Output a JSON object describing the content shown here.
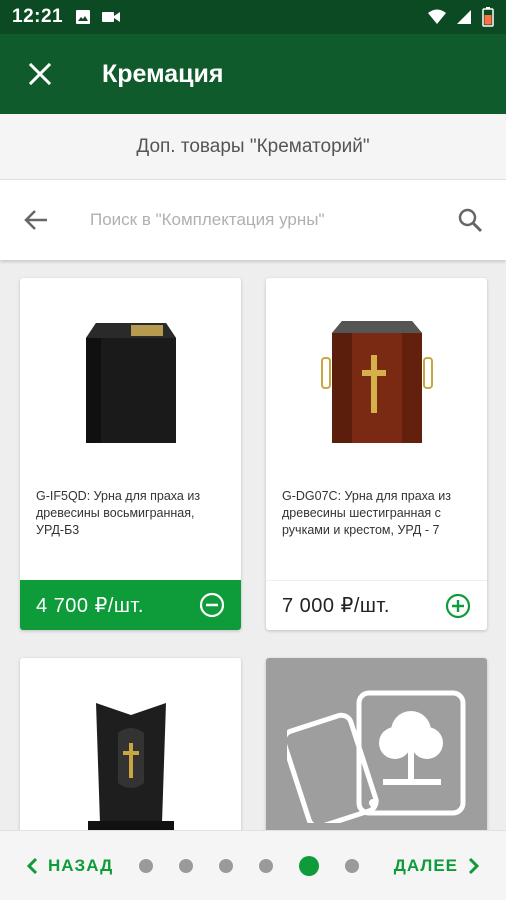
{
  "status_bar": {
    "time": "12:21",
    "icons_left": [
      "image-icon",
      "video-icon"
    ],
    "icons_right": [
      "wifi-icon",
      "signal-icon",
      "battery-icon"
    ]
  },
  "app_bar": {
    "title": "Кремация",
    "close_icon": "close-icon",
    "background_color": "#0f5b2b"
  },
  "subheader": {
    "text": "Доп. товары \"Крематорий\""
  },
  "search": {
    "placeholder": "Поиск в \"Комплектация урны\"",
    "back_icon": "arrow-left-icon",
    "search_icon": "search-icon"
  },
  "products": [
    {
      "description": "G-IF5QD: Урна для праха из древесины восьмигранная, УРД-Б3",
      "price": "4 700  ₽/шт.",
      "selected": true,
      "action_icon": "minus-circle-icon"
    },
    {
      "description": "G-DG07C: Урна для праха из древесины шестигранная с ручками и крестом, УРД - 7",
      "price": "7 000  ₽/шт.",
      "selected": false,
      "action_icon": "plus-circle-icon"
    },
    {
      "description": "",
      "price": "",
      "selected": false,
      "action_icon": ""
    },
    {
      "description": "",
      "price": "",
      "selected": false,
      "action_icon": "",
      "image": "image-placeholder-icon"
    }
  ],
  "bottom_nav": {
    "prev_label": "НАЗАД",
    "next_label": "ДАЛЕЕ",
    "pages_total": 6,
    "active_page": 5,
    "accent_color": "#0e9c3a"
  }
}
